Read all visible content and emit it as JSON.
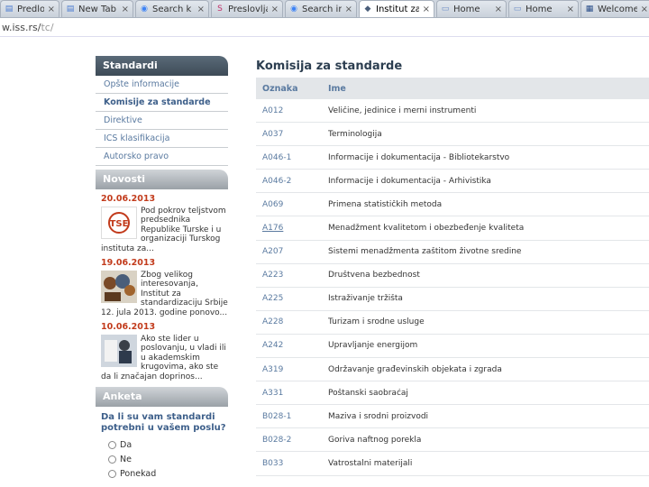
{
  "browser": {
    "tabs": [
      {
        "label": "Predlozi i",
        "icon": "page-icon"
      },
      {
        "label": "New Tab",
        "icon": "page-icon"
      },
      {
        "label": "Search   k",
        "icon": "search-icon"
      },
      {
        "label": "Preslovljav",
        "icon": "s-icon"
      },
      {
        "label": "Search   in",
        "icon": "search-icon"
      },
      {
        "label": "Institut za",
        "icon": "institut-icon",
        "active": true
      },
      {
        "label": "Home",
        "icon": "home-icon"
      },
      {
        "label": "Home",
        "icon": "home-icon"
      },
      {
        "label": "Welcome",
        "icon": "welcome-icon"
      }
    ],
    "address_host": "w.iss.rs/",
    "address_path": "tc/"
  },
  "sidebar": {
    "standardi_title": "Standardi",
    "items": [
      {
        "label": "Opšte informacije"
      },
      {
        "label": "Komisije za standarde",
        "bold": true
      },
      {
        "label": "Direktive"
      },
      {
        "label": "ICS klasifikacija"
      },
      {
        "label": "Autorsko pravo"
      }
    ],
    "novosti_title": "Novosti",
    "news": [
      {
        "date": "20.06.2013",
        "text": "Pod pokrov teljstvom predsednika Republike Turske i u organizaciji Turskog instituta za...",
        "logo": "TSE"
      },
      {
        "date": "19.06.2013",
        "text": "Zbog velikog interesovanja, Institut za standardizaciju Srbije 12. jula 2013. godine ponovo..."
      },
      {
        "date": "10.06.2013",
        "text": "Ako ste lider u poslovanju, u vladi ili u akademskim krugovima, ako ste da li značajan doprinos..."
      }
    ],
    "anketa_title": "Anketa",
    "poll_question": "Da li su vam standardi potrebni u vašem poslu?",
    "poll_options": [
      "Da",
      "Ne",
      "Ponekad"
    ]
  },
  "main": {
    "title": "Komisija za standarde",
    "col_code": "Oznaka",
    "col_name": "Ime",
    "rows": [
      {
        "code": "A012",
        "name": "Veličine, jedinice i merni instrumenti"
      },
      {
        "code": "A037",
        "name": "Terminologija"
      },
      {
        "code": "A046-1",
        "name": "Informacije i dokumentacija - Bibliotekarstvo"
      },
      {
        "code": "A046-2",
        "name": "Informacije i dokumentacija - Arhivistika"
      },
      {
        "code": "A069",
        "name": "Primena statističkih metoda"
      },
      {
        "code": "A176",
        "name": "Menadžment kvalitetom i obezbeđenje kvaliteta",
        "underline": true
      },
      {
        "code": "A207",
        "name": "Sistemi menadžmenta zaštitom životne sredine"
      },
      {
        "code": "A223",
        "name": "Društvena bezbednost"
      },
      {
        "code": "A225",
        "name": "Istraživanje tržišta"
      },
      {
        "code": "A228",
        "name": "Turizam i srodne usluge"
      },
      {
        "code": "A242",
        "name": "Upravljanje energijom"
      },
      {
        "code": "A319",
        "name": "Održavanje građevinskih objekata i zgrada"
      },
      {
        "code": "A331",
        "name": "Poštanski saobraćaj"
      },
      {
        "code": "B028-1",
        "name": "Maziva i srodni proizvodi"
      },
      {
        "code": "B028-2",
        "name": "Goriva naftnog porekla"
      },
      {
        "code": "B033",
        "name": "Vatrostalni materijali"
      }
    ]
  },
  "colors": {
    "accent": "#3d5f8a",
    "date": "#c23b1c",
    "header_dark": "#3d4b57"
  }
}
